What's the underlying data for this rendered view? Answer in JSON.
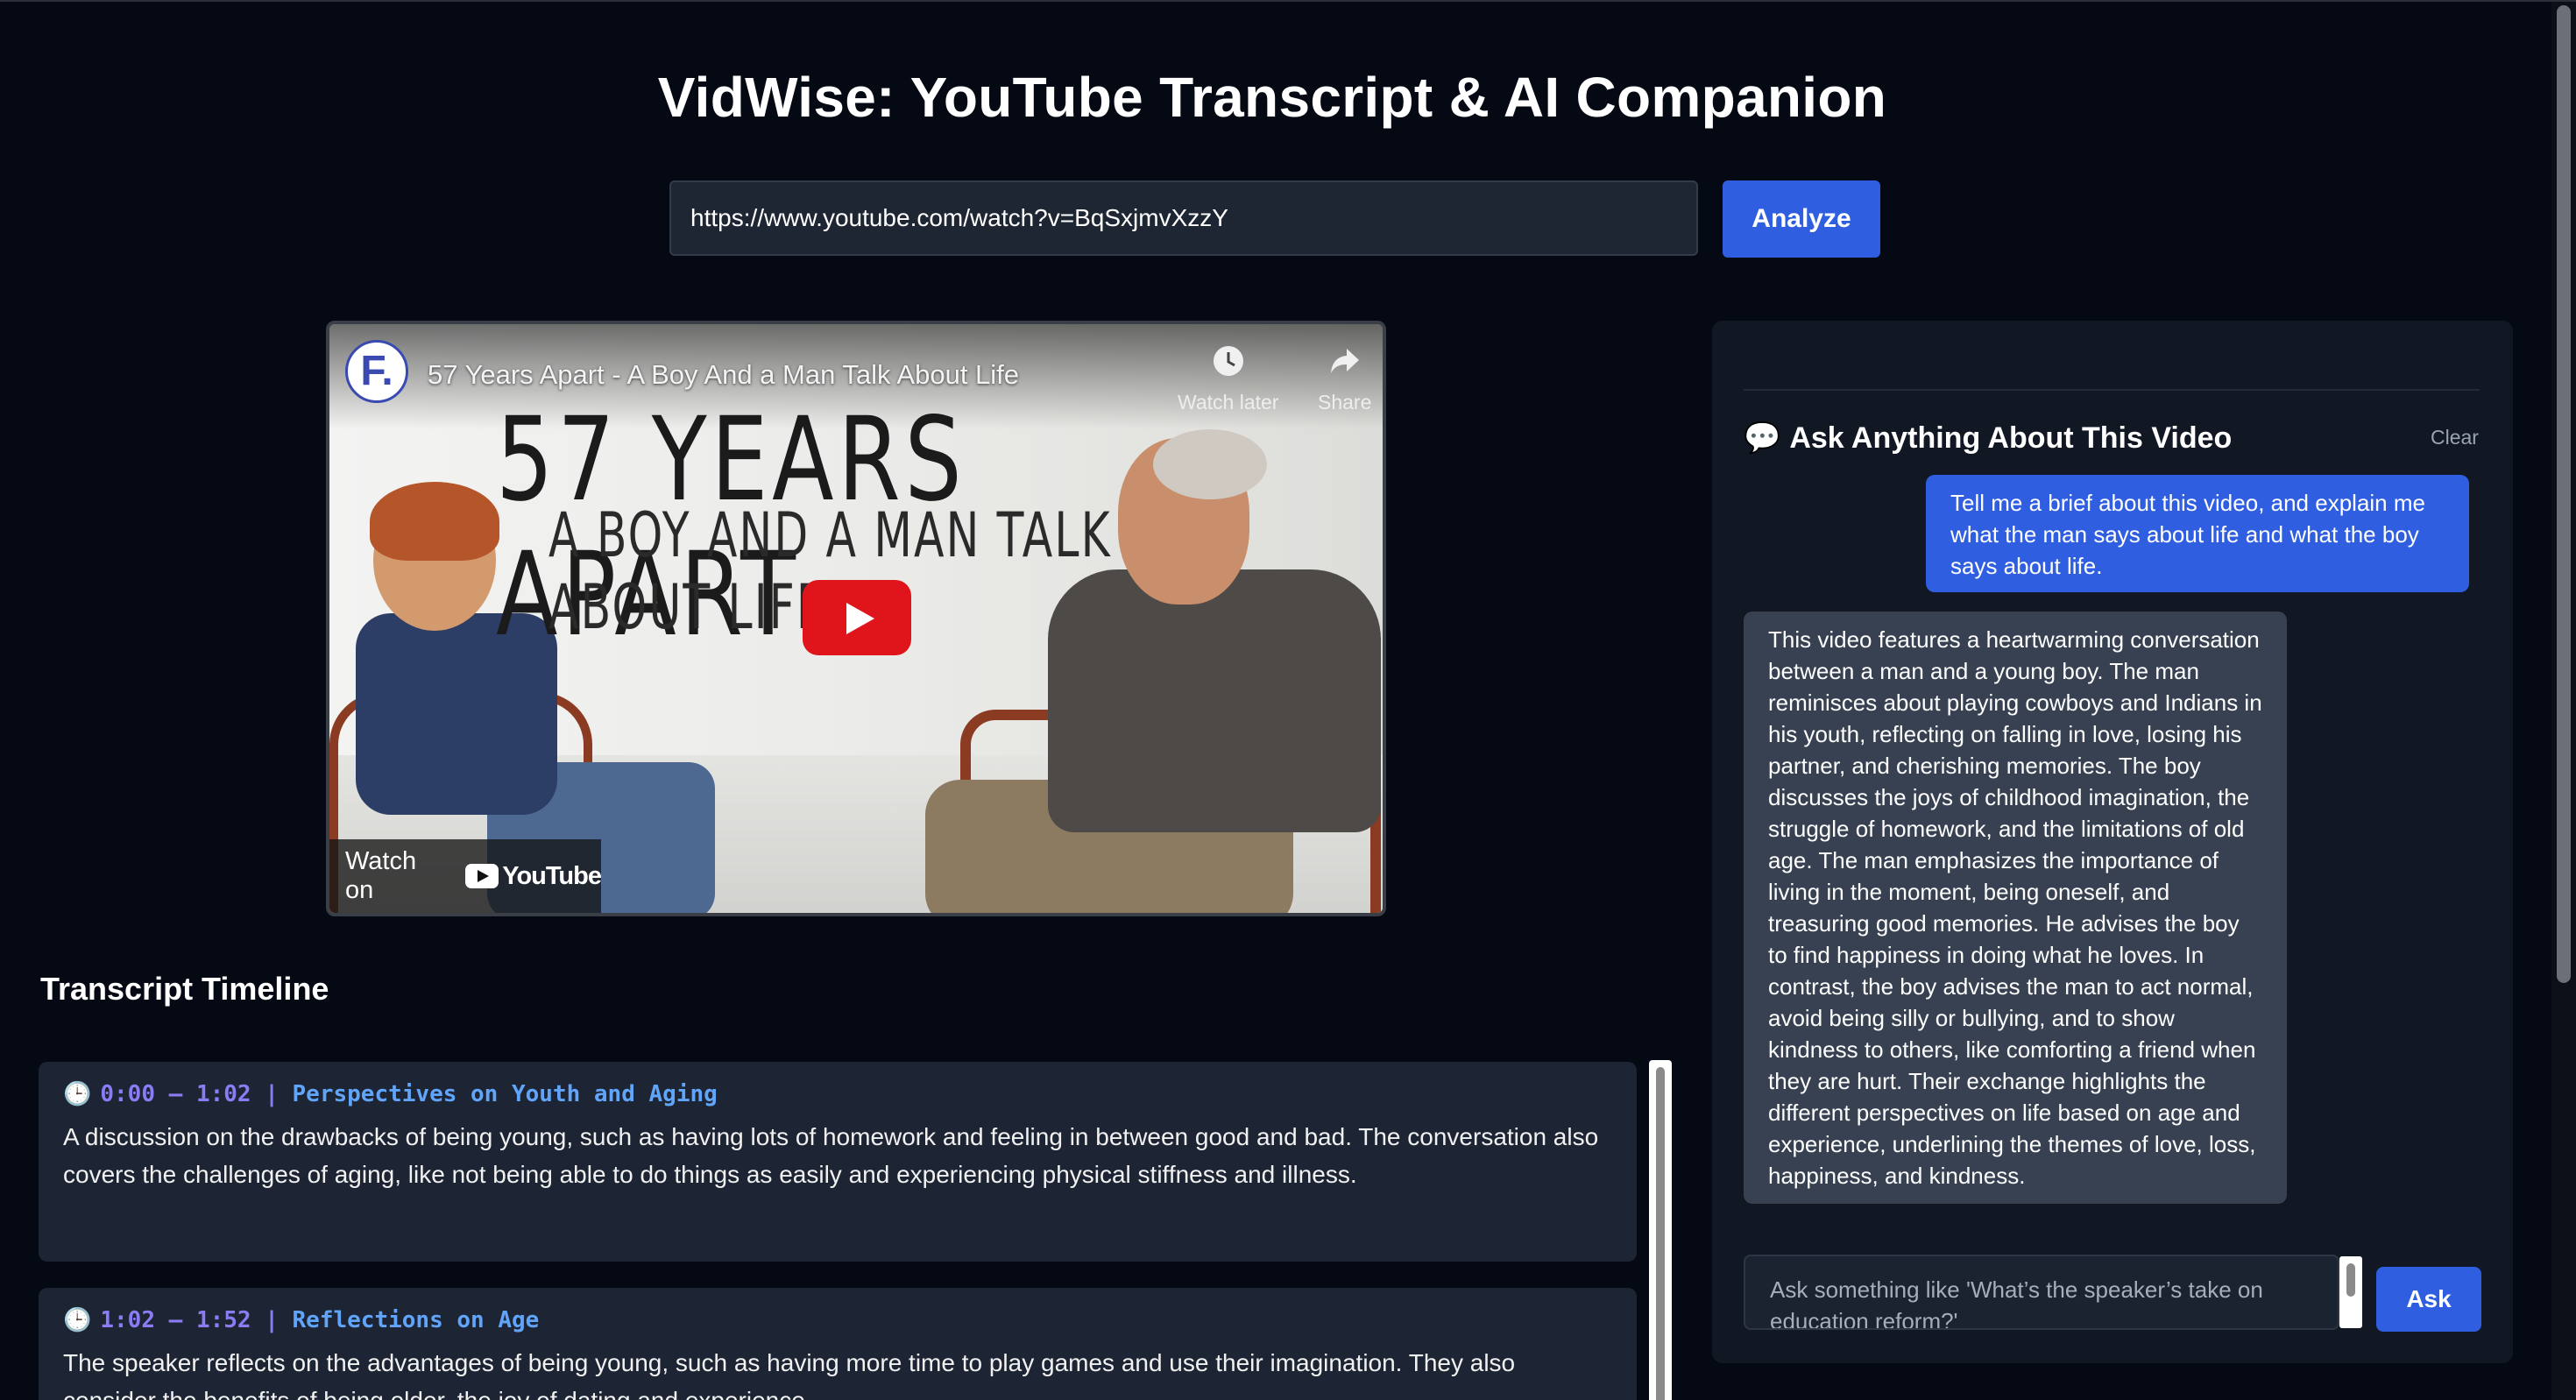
{
  "header": {
    "title": "VidWise: YouTube Transcript & AI Companion"
  },
  "search": {
    "url_value": "https://www.youtube.com/watch?v=BqSxjmvXzzY",
    "analyze_label": "Analyze"
  },
  "video": {
    "channel_initial": "F.",
    "overlay_title": "57 Years Apart - A Boy And a Man Talk About Life",
    "watch_later_label": "Watch later",
    "share_label": "Share",
    "thumbnail_title": "57 YEARS APART",
    "thumbnail_subtitle": "A BOY AND A MAN TALK ABOUT LIFE",
    "watch_on_label": "Watch on",
    "youtube_label": "YouTube"
  },
  "transcript": {
    "heading": "Transcript Timeline",
    "segments": [
      {
        "clock_icon": "🕒",
        "time": "0:00 – 1:02",
        "separator": " | ",
        "topic": "Perspectives on Youth and Aging",
        "text": "A discussion on the drawbacks of being young, such as having lots of homework and feeling in between good and bad. The conversation also covers the challenges of aging, like not being able to do things as easily and experiencing physical stiffness and illness."
      },
      {
        "clock_icon": "🕒",
        "time": "1:02 – 1:52",
        "separator": " | ",
        "topic": "Reflections on Age",
        "text": "The speaker reflects on the advantages of being young, such as having more time to play games and use their imagination. They also consider the benefits of being older, the joy of dating and experience."
      }
    ]
  },
  "chat": {
    "title_icon": "💬",
    "title": "Ask Anything About This Video",
    "clear_label": "Clear",
    "user_message": "Tell me a brief about this video, and explain me what the man says about life and what the boy says about life.",
    "ai_message": "This video features a heartwarming conversation between a man and a young boy. The man reminisces about playing cowboys and Indians in his youth, reflecting on falling in love, losing his partner, and cherishing memories. The boy discusses the joys of childhood imagination, the struggle of homework, and the limitations of old age. The man emphasizes the importance of living in the moment, being oneself, and treasuring good memories. He advises the boy to find happiness in doing what he loves. In contrast, the boy advises the man to act normal, avoid being silly or bullying, and to show kindness to others, like comforting a friend when they are hurt. Their exchange highlights the different perspectives on life based on age and experience, underlining the themes of love, loss, happiness, and kindness.",
    "input_placeholder": "Ask something like 'What’s the speaker’s take on education reform?'",
    "ask_label": "Ask"
  },
  "colors": {
    "background": "#050914",
    "accent": "#2f5fe0",
    "panel": "#111723",
    "segment_bg": "#1d2433",
    "time_color": "#8b7cf6",
    "topic_color": "#60a5fa",
    "ai_bubble": "#374151"
  }
}
